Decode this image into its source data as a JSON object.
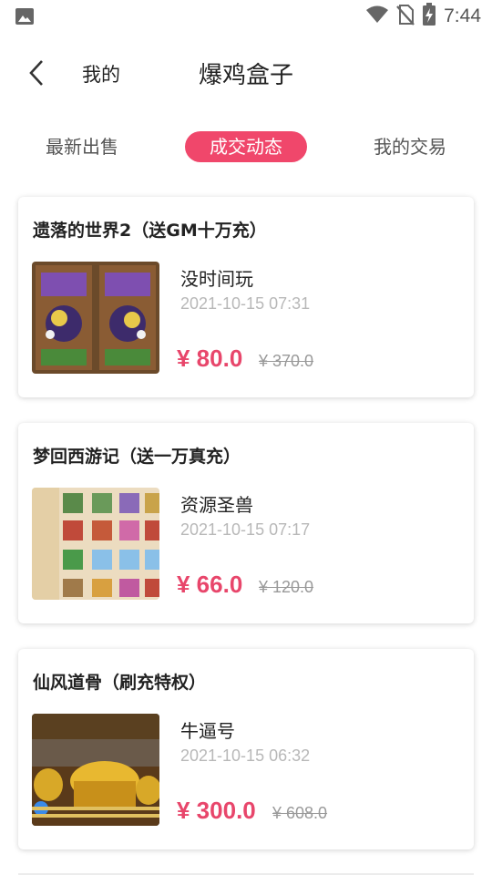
{
  "status_bar": {
    "time": "7:44",
    "icons": [
      "image-icon",
      "wifi-icon",
      "no-sim-icon",
      "battery-charging-icon"
    ]
  },
  "header": {
    "back_icon": "chevron-left-icon",
    "mine_label": "我的",
    "title": "爆鸡盒子"
  },
  "tabs": [
    {
      "label": "最新出售",
      "active": false
    },
    {
      "label": "成交动态",
      "active": true
    },
    {
      "label": "我的交易",
      "active": false
    }
  ],
  "colors": {
    "accent": "#f0476b",
    "price": "#e8466b",
    "muted": "#b8b8b8"
  },
  "deals": [
    {
      "title": "遗落的世界2（送GM十万充）",
      "seller": "没时间玩",
      "time": "2021-10-15 07:31",
      "price": "¥ 80.0",
      "original_price": "¥ 370.0"
    },
    {
      "title": "梦回西游记（送一万真充）",
      "seller": "资源圣兽",
      "time": "2021-10-15 07:17",
      "price": "¥ 66.0",
      "original_price": "¥ 120.0"
    },
    {
      "title": "仙风道骨（刷充特权）",
      "seller": "牛逼号",
      "time": "2021-10-15 06:32",
      "price": "¥ 300.0",
      "original_price": "¥ 608.0"
    }
  ]
}
